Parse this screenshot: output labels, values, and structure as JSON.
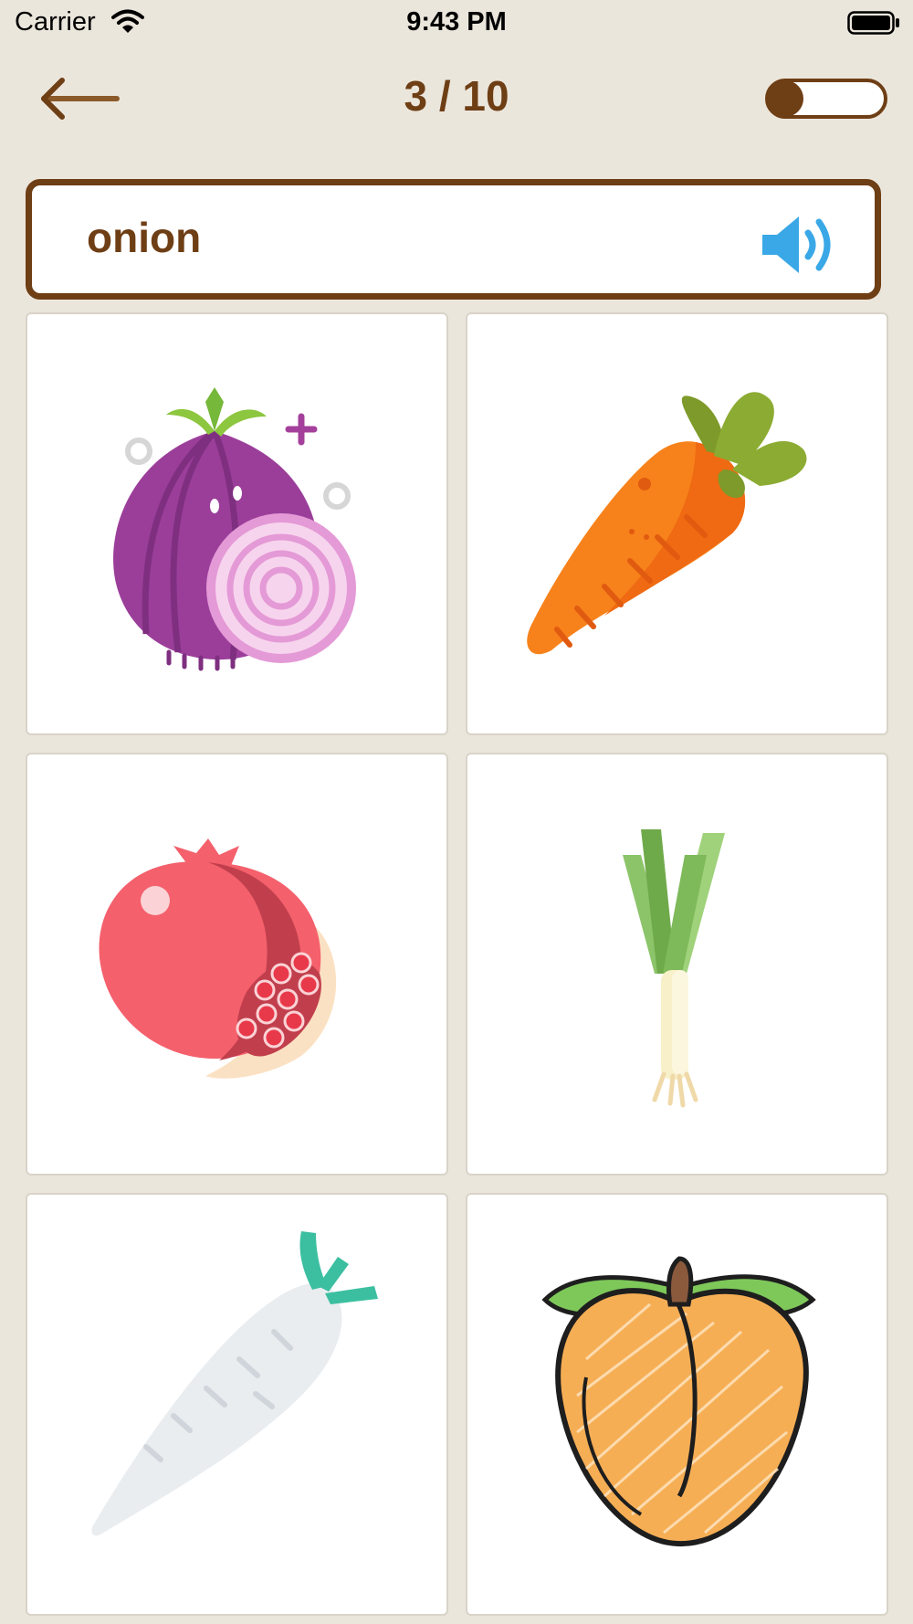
{
  "status_bar": {
    "carrier": "Carrier",
    "time": "9:43 PM"
  },
  "header": {
    "progress": "3 / 10",
    "toggle_level": 0.3
  },
  "prompt": {
    "word": "onion"
  },
  "choices": [
    {
      "icon": "onion-icon"
    },
    {
      "icon": "carrot-icon"
    },
    {
      "icon": "pomegranate-icon"
    },
    {
      "icon": "leek-icon"
    },
    {
      "icon": "daikon-radish-icon"
    },
    {
      "icon": "peach-icon"
    }
  ],
  "colors": {
    "accent": "#6e3e15",
    "background": "#ebe6dc",
    "speaker": "#3aa8e6"
  }
}
